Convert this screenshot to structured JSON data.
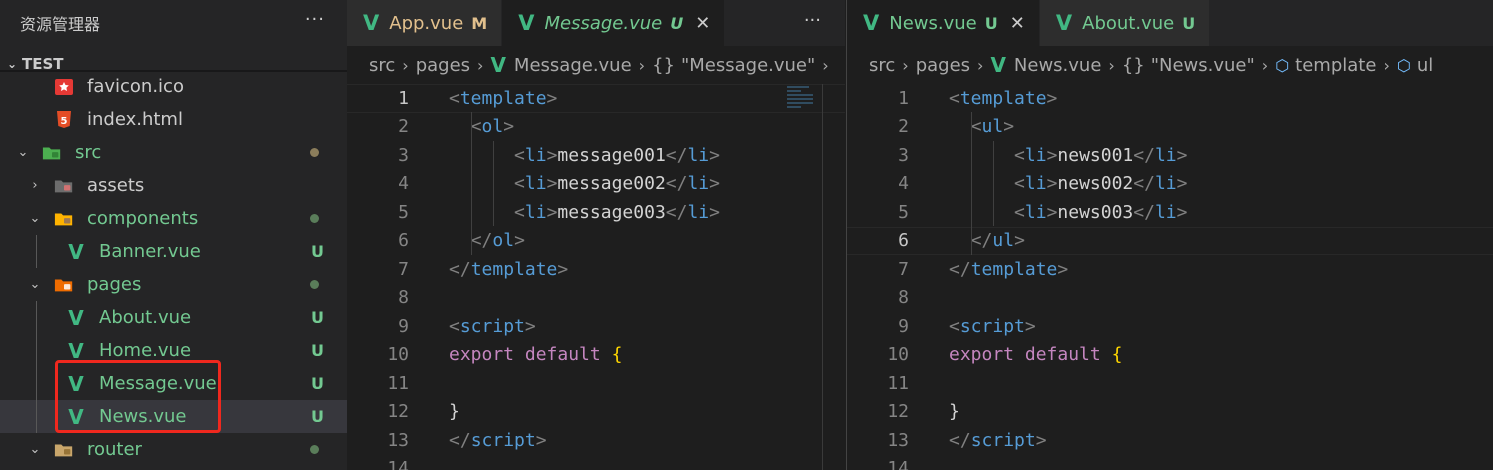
{
  "explorer": {
    "title": "资源管理器",
    "more": "···",
    "section": "TEST",
    "items": [
      {
        "label": "favicon.ico",
        "icon": "favicon-icon",
        "depth": 2,
        "kind": "file",
        "color": "#cccccc"
      },
      {
        "label": "index.html",
        "icon": "html5-icon",
        "depth": 2,
        "kind": "file",
        "color": "#cccccc"
      },
      {
        "label": "src",
        "icon": "folder-src-icon",
        "depth": 1,
        "kind": "folder-open",
        "color": "#73c991",
        "status": "dot",
        "status_color": "#8b7d5b"
      },
      {
        "label": "assets",
        "icon": "folder-assets-icon",
        "depth": 2,
        "kind": "folder-closed",
        "color": "#cccccc"
      },
      {
        "label": "components",
        "icon": "folder-components-icon",
        "depth": 2,
        "kind": "folder-open",
        "color": "#73c991",
        "status": "dot",
        "status_color": "#5a7d5a"
      },
      {
        "label": "Banner.vue",
        "icon": "vue-file-icon",
        "depth": 3,
        "kind": "file",
        "color": "#73c991",
        "badge": "U"
      },
      {
        "label": "pages",
        "icon": "folder-pages-icon",
        "depth": 2,
        "kind": "folder-open",
        "color": "#73c991",
        "status": "dot",
        "status_color": "#5a7d5a"
      },
      {
        "label": "About.vue",
        "icon": "vue-file-icon",
        "depth": 3,
        "kind": "file",
        "color": "#73c991",
        "badge": "U"
      },
      {
        "label": "Home.vue",
        "icon": "vue-file-icon",
        "depth": 3,
        "kind": "file",
        "color": "#73c991",
        "badge": "U"
      },
      {
        "label": "Message.vue",
        "icon": "vue-file-icon",
        "depth": 3,
        "kind": "file",
        "color": "#73c991",
        "badge": "U"
      },
      {
        "label": "News.vue",
        "icon": "vue-file-icon",
        "depth": 3,
        "kind": "file",
        "color": "#73c991",
        "badge": "U",
        "selected": true
      },
      {
        "label": "router",
        "icon": "folder-router-icon",
        "depth": 2,
        "kind": "folder-open",
        "color": "#73c991",
        "status": "dot",
        "status_color": "#5a7d5a"
      }
    ]
  },
  "editor_left": {
    "tabs": [
      {
        "label": "App.vue",
        "badge": "M",
        "active": false,
        "italic": false,
        "modified": true
      },
      {
        "label": "Message.vue",
        "badge": "U",
        "active": true,
        "italic": true,
        "close": "✕"
      }
    ],
    "more": "···",
    "breadcrumb": {
      "a": "src",
      "b": "pages",
      "c": "Message.vue",
      "d": "\"Message.vue\"",
      "brace": "{}"
    },
    "current_line": 1,
    "lines": [
      [
        {
          "t": "<",
          "c": "punc"
        },
        {
          "t": "template",
          "c": "tag"
        },
        {
          "t": ">",
          "c": "punc"
        }
      ],
      [
        {
          "t": "  "
        },
        {
          "t": "<",
          "c": "punc"
        },
        {
          "t": "ol",
          "c": "tag"
        },
        {
          "t": ">",
          "c": "punc"
        }
      ],
      [
        {
          "t": "      "
        },
        {
          "t": "<",
          "c": "punc"
        },
        {
          "t": "li",
          "c": "tag"
        },
        {
          "t": ">",
          "c": "punc"
        },
        {
          "t": "message001",
          "c": "txt"
        },
        {
          "t": "</",
          "c": "punc"
        },
        {
          "t": "li",
          "c": "tag"
        },
        {
          "t": ">",
          "c": "punc"
        }
      ],
      [
        {
          "t": "      "
        },
        {
          "t": "<",
          "c": "punc"
        },
        {
          "t": "li",
          "c": "tag"
        },
        {
          "t": ">",
          "c": "punc"
        },
        {
          "t": "message002",
          "c": "txt"
        },
        {
          "t": "</",
          "c": "punc"
        },
        {
          "t": "li",
          "c": "tag"
        },
        {
          "t": ">",
          "c": "punc"
        }
      ],
      [
        {
          "t": "      "
        },
        {
          "t": "<",
          "c": "punc"
        },
        {
          "t": "li",
          "c": "tag"
        },
        {
          "t": ">",
          "c": "punc"
        },
        {
          "t": "message003",
          "c": "txt"
        },
        {
          "t": "</",
          "c": "punc"
        },
        {
          "t": "li",
          "c": "tag"
        },
        {
          "t": ">",
          "c": "punc"
        }
      ],
      [
        {
          "t": "  "
        },
        {
          "t": "</",
          "c": "punc"
        },
        {
          "t": "ol",
          "c": "tag"
        },
        {
          "t": ">",
          "c": "punc"
        }
      ],
      [
        {
          "t": "</",
          "c": "punc"
        },
        {
          "t": "template",
          "c": "tag"
        },
        {
          "t": ">",
          "c": "punc"
        }
      ],
      [],
      [
        {
          "t": "<",
          "c": "punc"
        },
        {
          "t": "script",
          "c": "tag"
        },
        {
          "t": ">",
          "c": "punc"
        }
      ],
      [
        {
          "t": "export",
          "c": "kw"
        },
        {
          "t": " "
        },
        {
          "t": "default",
          "c": "kw"
        },
        {
          "t": " "
        },
        {
          "t": "{",
          "c": "brace"
        }
      ],
      [],
      [
        {
          "t": "}",
          "c": "txt"
        }
      ],
      [
        {
          "t": "</",
          "c": "punc"
        },
        {
          "t": "script",
          "c": "tag"
        },
        {
          "t": ">",
          "c": "punc"
        }
      ],
      []
    ]
  },
  "editor_right": {
    "tabs": [
      {
        "label": "News.vue",
        "badge": "U",
        "active": true,
        "italic": false,
        "close": "✕"
      },
      {
        "label": "About.vue",
        "badge": "U",
        "active": false,
        "italic": false
      }
    ],
    "breadcrumb": {
      "a": "src",
      "b": "pages",
      "c": "News.vue",
      "d": "\"News.vue\"",
      "brace": "{}",
      "e": "template",
      "f": "ul"
    },
    "current_line": 6,
    "lines": [
      [
        {
          "t": "<",
          "c": "punc"
        },
        {
          "t": "template",
          "c": "tag"
        },
        {
          "t": ">",
          "c": "punc"
        }
      ],
      [
        {
          "t": "  "
        },
        {
          "t": "<",
          "c": "punc"
        },
        {
          "t": "ul",
          "c": "tag"
        },
        {
          "t": ">",
          "c": "punc"
        }
      ],
      [
        {
          "t": "      "
        },
        {
          "t": "<",
          "c": "punc"
        },
        {
          "t": "li",
          "c": "tag"
        },
        {
          "t": ">",
          "c": "punc"
        },
        {
          "t": "news001",
          "c": "txt"
        },
        {
          "t": "</",
          "c": "punc"
        },
        {
          "t": "li",
          "c": "tag"
        },
        {
          "t": ">",
          "c": "punc"
        }
      ],
      [
        {
          "t": "      "
        },
        {
          "t": "<",
          "c": "punc"
        },
        {
          "t": "li",
          "c": "tag"
        },
        {
          "t": ">",
          "c": "punc"
        },
        {
          "t": "news002",
          "c": "txt"
        },
        {
          "t": "</",
          "c": "punc"
        },
        {
          "t": "li",
          "c": "tag"
        },
        {
          "t": ">",
          "c": "punc"
        }
      ],
      [
        {
          "t": "      "
        },
        {
          "t": "<",
          "c": "punc"
        },
        {
          "t": "li",
          "c": "tag"
        },
        {
          "t": ">",
          "c": "punc"
        },
        {
          "t": "news003",
          "c": "txt"
        },
        {
          "t": "</",
          "c": "punc"
        },
        {
          "t": "li",
          "c": "tag"
        },
        {
          "t": ">",
          "c": "punc"
        }
      ],
      [
        {
          "t": "  "
        },
        {
          "t": "</",
          "c": "punc"
        },
        {
          "t": "ul",
          "c": "tag"
        },
        {
          "t": ">",
          "c": "punc"
        }
      ],
      [
        {
          "t": "</",
          "c": "punc"
        },
        {
          "t": "template",
          "c": "tag"
        },
        {
          "t": ">",
          "c": "punc"
        }
      ],
      [],
      [
        {
          "t": "<",
          "c": "punc"
        },
        {
          "t": "script",
          "c": "tag"
        },
        {
          "t": ">",
          "c": "punc"
        }
      ],
      [
        {
          "t": "export",
          "c": "kw"
        },
        {
          "t": " "
        },
        {
          "t": "default",
          "c": "kw"
        },
        {
          "t": " "
        },
        {
          "t": "{",
          "c": "brace"
        }
      ],
      [],
      [
        {
          "t": "}",
          "c": "txt"
        }
      ],
      [
        {
          "t": "</",
          "c": "punc"
        },
        {
          "t": "script",
          "c": "tag"
        },
        {
          "t": ">",
          "c": "punc"
        }
      ],
      []
    ]
  },
  "colors": {
    "vue_green": "#41b883",
    "untracked": "#73c991",
    "modified": "#e2c08d",
    "highlight_box": "#f0281e"
  }
}
